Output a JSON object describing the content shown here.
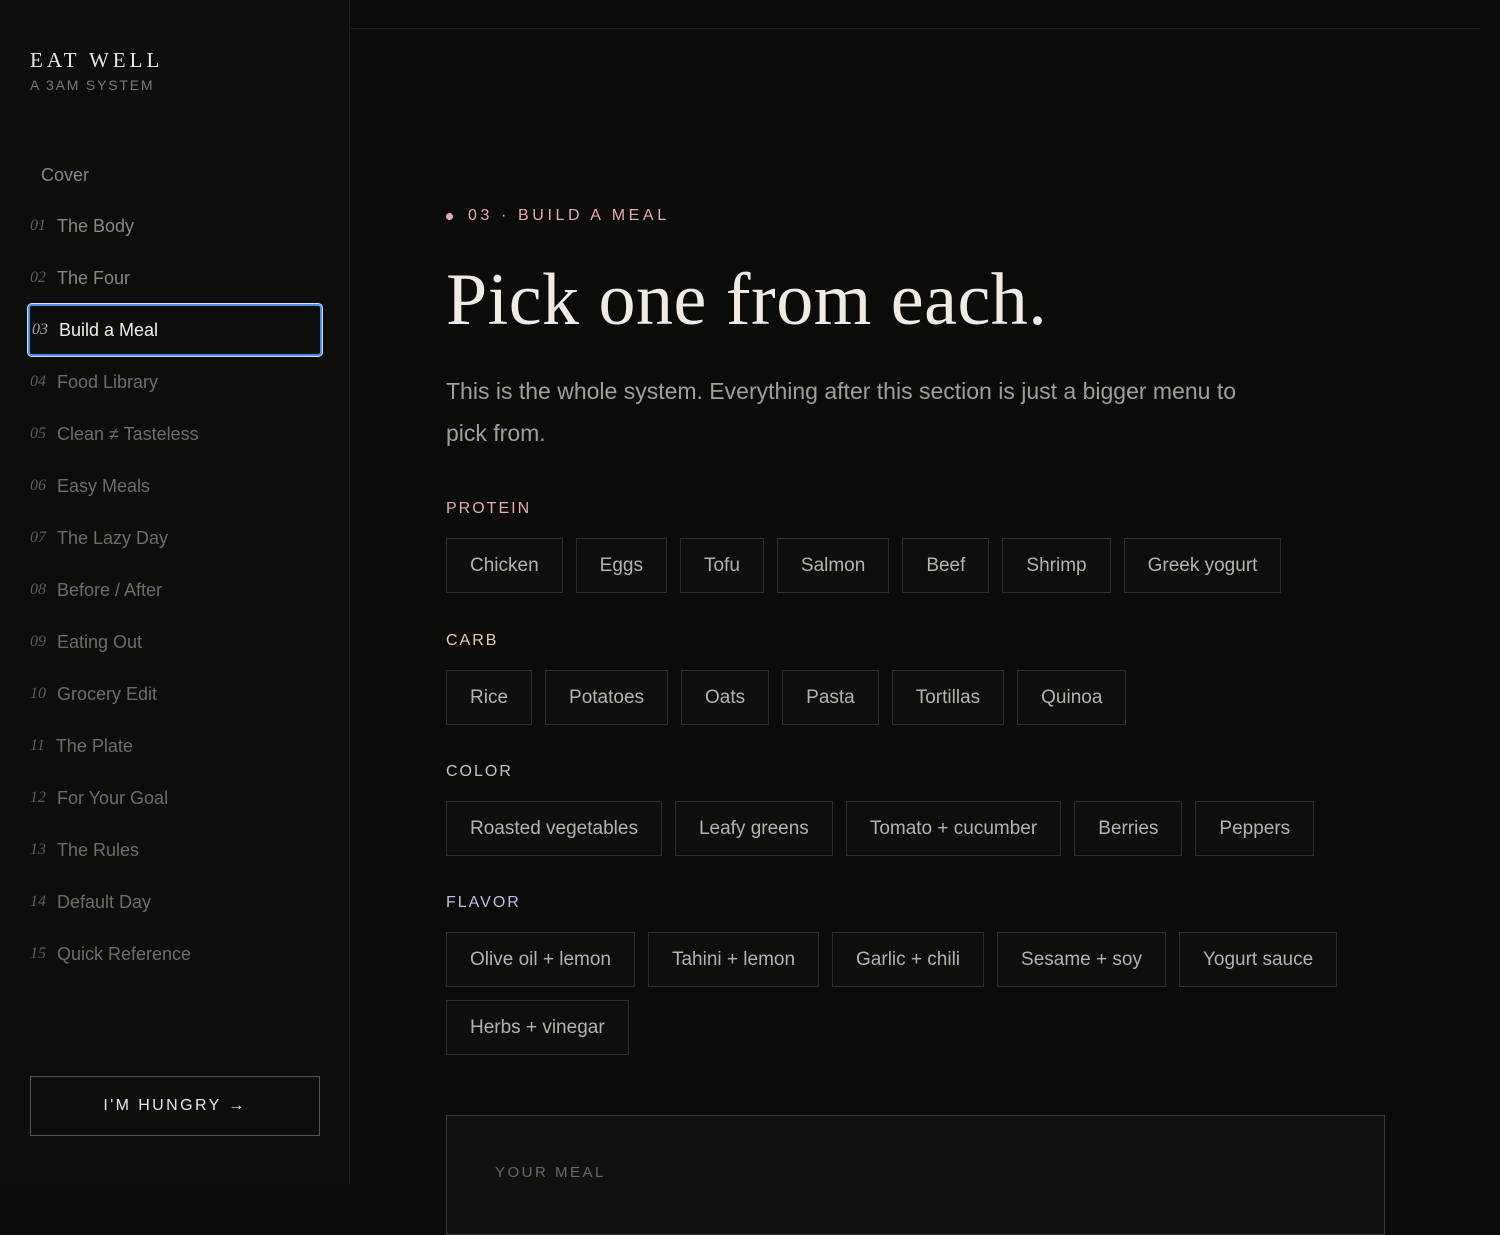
{
  "brand": {
    "title": "EAT WELL",
    "subtitle": "A 3AM SYSTEM"
  },
  "nav": {
    "cover": "Cover",
    "items": [
      {
        "num": "01",
        "label": "The Body"
      },
      {
        "num": "02",
        "label": "The Four"
      },
      {
        "num": "03",
        "label": "Build a Meal"
      },
      {
        "num": "04",
        "label": "Food Library"
      },
      {
        "num": "05",
        "label": "Clean ≠ Tasteless"
      },
      {
        "num": "06",
        "label": "Easy Meals"
      },
      {
        "num": "07",
        "label": "The Lazy Day"
      },
      {
        "num": "08",
        "label": "Before / After"
      },
      {
        "num": "09",
        "label": "Eating Out"
      },
      {
        "num": "10",
        "label": "Grocery Edit"
      },
      {
        "num": "11",
        "label": "The Plate"
      },
      {
        "num": "12",
        "label": "For Your Goal"
      },
      {
        "num": "13",
        "label": "The Rules"
      },
      {
        "num": "14",
        "label": "Default Day"
      },
      {
        "num": "15",
        "label": "Quick Reference"
      }
    ],
    "active_index": 2
  },
  "cta": {
    "label": "I'M HUNGRY →"
  },
  "section": {
    "eyebrow": "03 · BUILD A MEAL",
    "headline": "Pick one from each.",
    "lede": "This is the whole system. Everything after this section is just a bigger menu to pick from."
  },
  "groups": [
    {
      "label": "PROTEIN",
      "color": "#e6a9b0",
      "items": [
        "Chicken",
        "Eggs",
        "Tofu",
        "Salmon",
        "Beef",
        "Shrimp",
        "Greek yogurt"
      ]
    },
    {
      "label": "CARB",
      "color": "#e8cba8",
      "items": [
        "Rice",
        "Potatoes",
        "Oats",
        "Pasta",
        "Tortillas",
        "Quinoa"
      ]
    },
    {
      "label": "COLOR",
      "color": "#c9c4ba",
      "items": [
        "Roasted vegetables",
        "Leafy greens",
        "Tomato + cucumber",
        "Berries",
        "Peppers"
      ]
    },
    {
      "label": "FLAVOR",
      "color": "#c6b6e6",
      "items": [
        "Olive oil + lemon",
        "Tahini + lemon",
        "Garlic + chili",
        "Sesame + soy",
        "Yogurt sauce",
        "Herbs + vinegar"
      ]
    }
  ],
  "meal": {
    "label": "YOUR MEAL"
  },
  "colors": {
    "accent_pink": "#e6a9b0",
    "focus_ring": "#4a8fe8",
    "background": "#0b0b0a"
  }
}
